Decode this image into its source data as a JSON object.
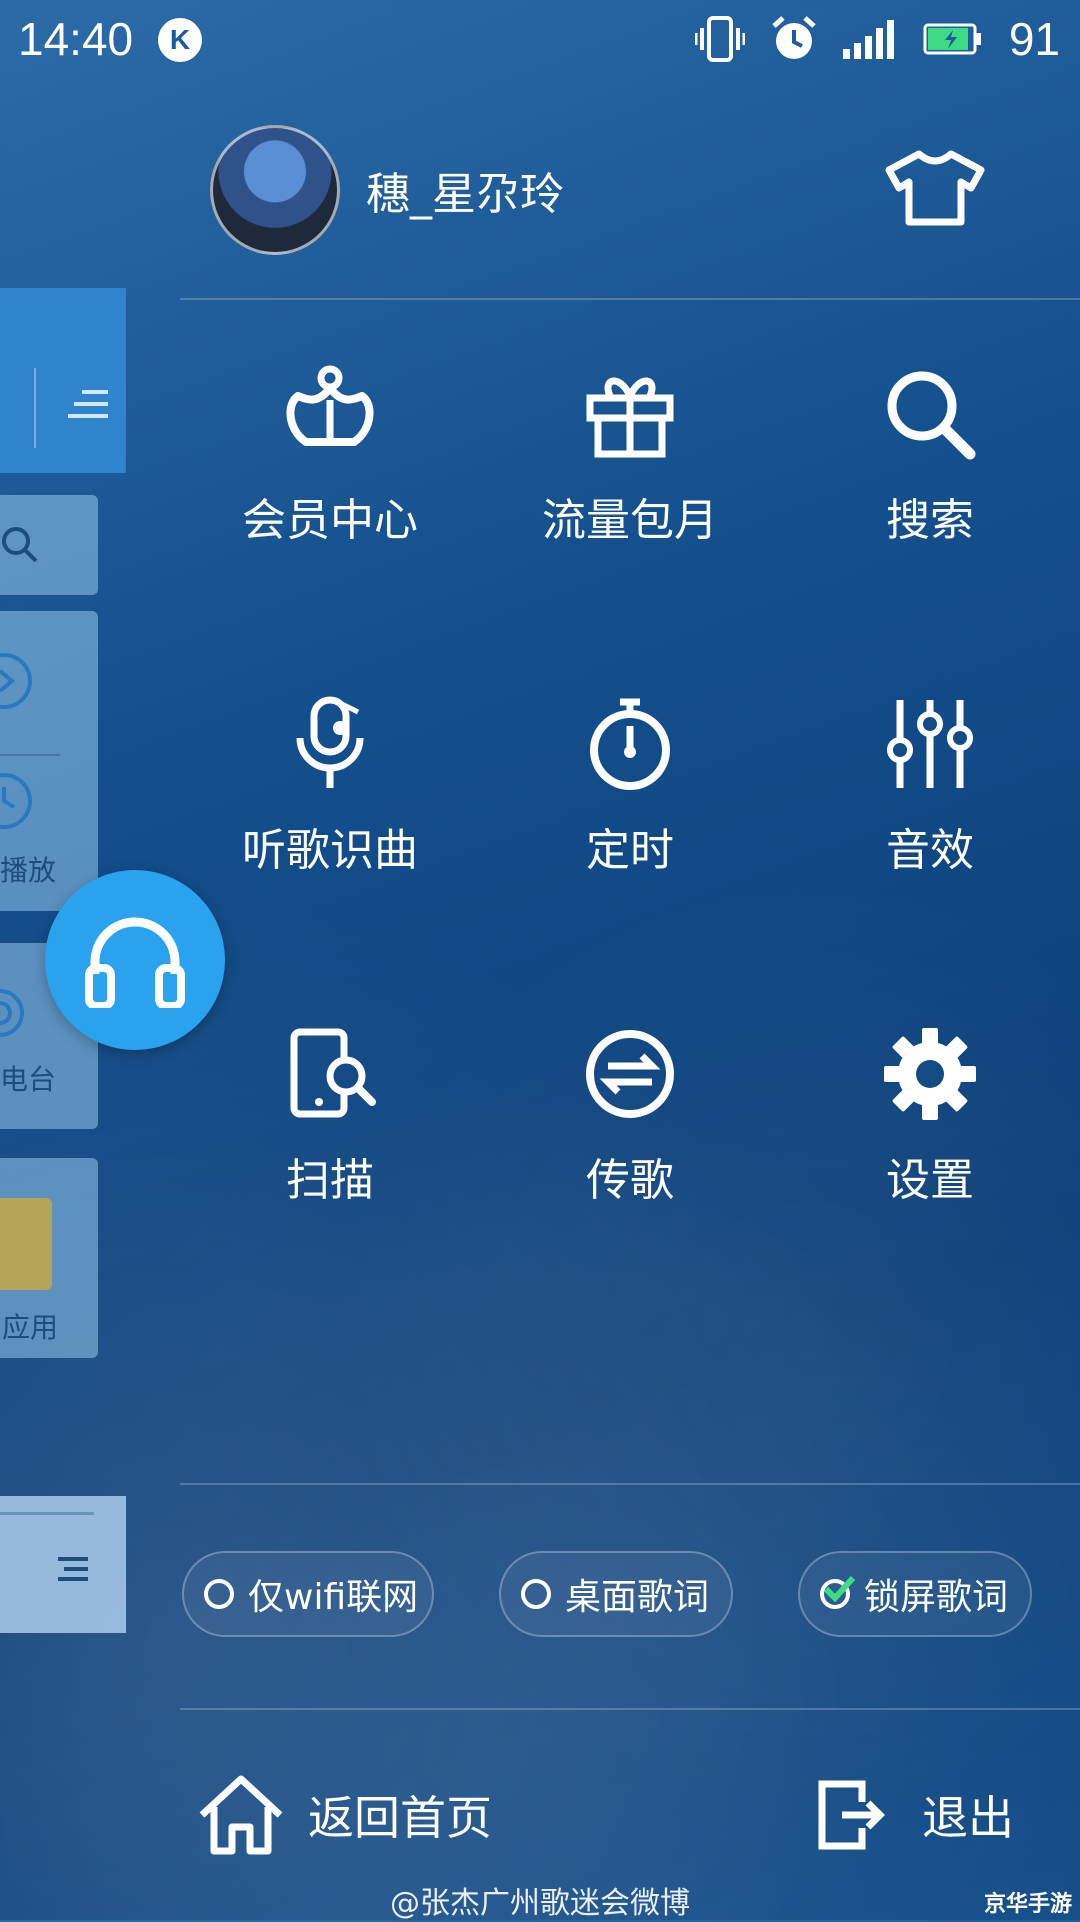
{
  "status_bar": {
    "time": "14:40",
    "app_badge": "K",
    "battery_percent": "91",
    "battery_level": 0.91,
    "icons": [
      "vibrate-icon",
      "alarm-icon",
      "signal-icon",
      "battery-charging-icon"
    ]
  },
  "profile": {
    "username": "穗_星尕玲",
    "skin_icon": "tshirt-icon"
  },
  "background_app": {
    "labels": [
      "播放",
      "电台",
      "品应用"
    ]
  },
  "menu": {
    "items": [
      {
        "label": "会员中心",
        "icon": "crown-icon"
      },
      {
        "label": "流量包月",
        "icon": "gift-icon"
      },
      {
        "label": "搜索",
        "icon": "search-icon"
      },
      {
        "label": "听歌识曲",
        "icon": "mic-note-icon"
      },
      {
        "label": "定时",
        "icon": "timer-icon"
      },
      {
        "label": "音效",
        "icon": "equalizer-icon"
      },
      {
        "label": "扫描",
        "icon": "scan-icon"
      },
      {
        "label": "传歌",
        "icon": "transfer-icon"
      },
      {
        "label": "设置",
        "icon": "gear-icon"
      }
    ]
  },
  "toggles": [
    {
      "label": "仅wifi联网",
      "checked": false
    },
    {
      "label": "桌面歌词",
      "checked": false
    },
    {
      "label": "锁屏歌词",
      "checked": true
    }
  ],
  "bottom": {
    "home_label": "返回首页",
    "exit_label": "退出"
  },
  "watermark": "@张杰广州歌迷会微博",
  "corner_mark": "京华手游",
  "colors": {
    "accent": "#2aa2ee",
    "check": "#3ddc84"
  }
}
